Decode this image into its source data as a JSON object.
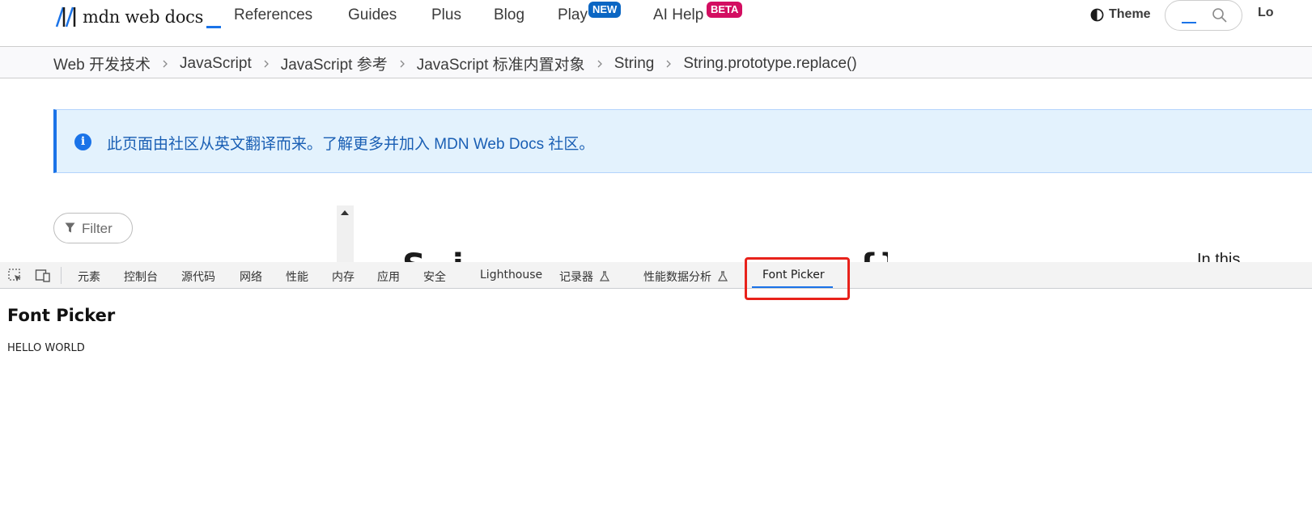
{
  "nav": {
    "logo_text": "mdn web docs",
    "items": [
      "References",
      "Guides",
      "Plus",
      "Blog",
      "Play",
      "AI Help"
    ],
    "badges": {
      "play": "NEW",
      "ai_help": "BETA"
    },
    "theme_label": "Theme",
    "login_peek": "Lo"
  },
  "breadcrumb": [
    "Web 开发技术",
    "JavaScript",
    "JavaScript 参考",
    "JavaScript 标准内置对象",
    "String",
    "String.prototype.replace()"
  ],
  "notice": {
    "text": "此页面由社区从英文翻译而来。了解更多并加入 ",
    "link": "MDN Web Docs 社区",
    "suffix": "。"
  },
  "sidebar": {
    "filter_placeholder": "Filter"
  },
  "content_peek": {
    "right_text": "In this"
  },
  "devtools": {
    "tabs": [
      "元素",
      "控制台",
      "源代码",
      "网络",
      "性能",
      "内存",
      "应用",
      "安全",
      "Lighthouse",
      "记录器",
      "性能数据分析",
      "Font Picker"
    ],
    "active_tab": "Font Picker",
    "panel_title": "Font Picker",
    "panel_text": "HELLO WORLD"
  },
  "colors": {
    "accent": "#1a73e8",
    "badge_new": "#0b66c3",
    "badge_beta": "#d30e61",
    "notice_bg": "#e3f2fd",
    "highlight": "#e8221b"
  }
}
